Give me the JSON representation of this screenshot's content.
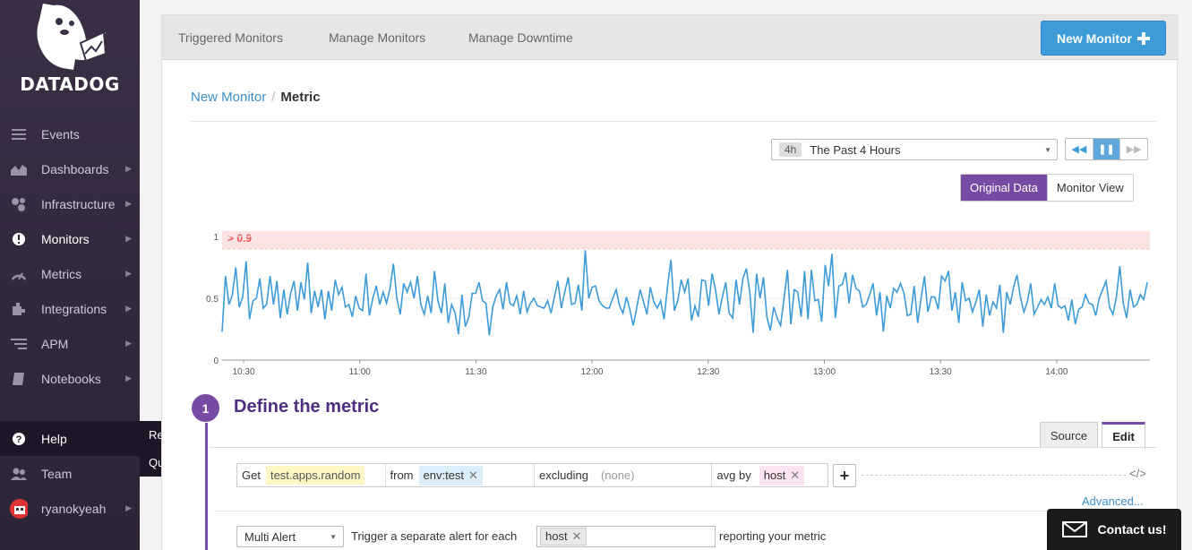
{
  "brand": {
    "name": "DATADOG",
    "accent": "#774aa4",
    "link": "#3d8fc9"
  },
  "sidebar": {
    "items": [
      {
        "label": "Events",
        "icon": "events-icon",
        "chevron": false
      },
      {
        "label": "Dashboards",
        "icon": "dashboards-icon",
        "chevron": true
      },
      {
        "label": "Infrastructure",
        "icon": "infrastructure-icon",
        "chevron": true
      },
      {
        "label": "Monitors",
        "icon": "monitors-icon",
        "chevron": true,
        "active": true
      },
      {
        "label": "Metrics",
        "icon": "metrics-icon",
        "chevron": true
      },
      {
        "label": "Integrations",
        "icon": "integrations-icon",
        "chevron": true
      },
      {
        "label": "APM",
        "icon": "apm-icon",
        "chevron": true
      },
      {
        "label": "Notebooks",
        "icon": "notebooks-icon",
        "chevron": true
      }
    ],
    "help": {
      "label": "Help",
      "menu": [
        "Resources",
        "Quick Start"
      ]
    },
    "team": {
      "label": "Team"
    },
    "user": {
      "label": "ryanokyeah"
    }
  },
  "topbar": {
    "tabs": [
      "Triggered Monitors",
      "Manage Monitors",
      "Manage Downtime"
    ],
    "new_monitor": "New Monitor"
  },
  "breadcrumb": {
    "parent": "New Monitor",
    "separator": "/",
    "current": "Metric"
  },
  "timeframe": {
    "badge": "4h",
    "label": "The Past 4 Hours"
  },
  "view_toggle": {
    "original": "Original Data",
    "monitor": "Monitor View"
  },
  "chart_data": {
    "type": "line",
    "x": [
      "10:30",
      "11:00",
      "11:30",
      "12:00",
      "12:30",
      "13:00",
      "13:30",
      "14:00"
    ],
    "y_ticks": [
      "0",
      "0.5",
      "1"
    ],
    "ylim": [
      0,
      1
    ],
    "threshold": {
      "label": "> 0.9",
      "value": 0.9,
      "color": "#f05252"
    },
    "series": [
      {
        "color": "#3d9bd8",
        "values": [
          0.23,
          0.68,
          0.45,
          0.53,
          0.75,
          0.43,
          0.51,
          0.8,
          0.33,
          0.48,
          0.5,
          0.66,
          0.42,
          0.45,
          0.68,
          0.45,
          0.64,
          0.34,
          0.57,
          0.37,
          0.54,
          0.64,
          0.4,
          0.63,
          0.49,
          0.79,
          0.38,
          0.56,
          0.43,
          0.57,
          0.33,
          0.56,
          0.4,
          0.65,
          0.53,
          0.59,
          0.43,
          0.45,
          0.35,
          0.52,
          0.42,
          0.4,
          0.7,
          0.36,
          0.5,
          0.6,
          0.45,
          0.55,
          0.46,
          0.58,
          0.78,
          0.5,
          0.37,
          0.62,
          0.55,
          0.63,
          0.5,
          0.68,
          0.45,
          0.37,
          0.52,
          0.38,
          0.72,
          0.48,
          0.38,
          0.62,
          0.3,
          0.45,
          0.38,
          0.21,
          0.53,
          0.27,
          0.35,
          0.54,
          0.54,
          0.63,
          0.48,
          0.46,
          0.2,
          0.43,
          0.52,
          0.57,
          0.41,
          0.63,
          0.46,
          0.44,
          0.52,
          0.37,
          0.56,
          0.39,
          0.46,
          0.5,
          0.44,
          0.43,
          0.42,
          0.48,
          0.38,
          0.51,
          0.64,
          0.42,
          0.55,
          0.67,
          0.45,
          0.46,
          0.61,
          0.4,
          0.89,
          0.5,
          0.59,
          0.6,
          0.48,
          0.44,
          0.42,
          0.42,
          0.5,
          0.57,
          0.44,
          0.38,
          0.51,
          0.41,
          0.28,
          0.42,
          0.57,
          0.47,
          0.37,
          0.59,
          0.47,
          0.42,
          0.48,
          0.33,
          0.6,
          0.81,
          0.4,
          0.48,
          0.65,
          0.55,
          0.66,
          0.32,
          0.44,
          0.35,
          0.65,
          0.64,
          0.44,
          0.7,
          0.57,
          0.37,
          0.51,
          0.63,
          0.38,
          0.34,
          0.65,
          0.45,
          0.66,
          0.74,
          0.55,
          0.22,
          0.7,
          0.5,
          0.67,
          0.35,
          0.24,
          0.43,
          0.34,
          0.28,
          0.5,
          0.73,
          0.29,
          0.57,
          0.55,
          0.35,
          0.72,
          0.33,
          0.73,
          0.48,
          0.49,
          0.31,
          0.77,
          0.6,
          0.86,
          0.34,
          0.6,
          0.61,
          0.71,
          0.46,
          0.69,
          0.58,
          0.56,
          0.43,
          0.45,
          0.53,
          0.62,
          0.36,
          0.55,
          0.23,
          0.52,
          0.42,
          0.58,
          0.55,
          0.62,
          0.54,
          0.36,
          0.37,
          0.6,
          0.3,
          0.5,
          0.68,
          0.39,
          0.51,
          0.51,
          0.41,
          0.68,
          0.64,
          0.72,
          0.4,
          0.55,
          0.3,
          0.63,
          0.48,
          0.5,
          0.39,
          0.47,
          0.57,
          0.27,
          0.53,
          0.36,
          0.47,
          0.42,
          0.61,
          0.22,
          0.55,
          0.45,
          0.59,
          0.69,
          0.51,
          0.39,
          0.47,
          0.62,
          0.37,
          0.43,
          0.49,
          0.45,
          0.51,
          0.42,
          0.62,
          0.44,
          0.42,
          0.44,
          0.32,
          0.49,
          0.29,
          0.41,
          0.43,
          0.53,
          0.46,
          0.45,
          0.36,
          0.5,
          0.57,
          0.64,
          0.43,
          0.37,
          0.51,
          0.76,
          0.46,
          0.34,
          0.57,
          0.43,
          0.45,
          0.53,
          0.49,
          0.63
        ]
      }
    ]
  },
  "define": {
    "step": "1",
    "title": "Define the metric",
    "tabs": {
      "source": "Source",
      "edit": "Edit"
    },
    "query": {
      "get": "Get",
      "metric": "test.apps.random",
      "from_label": "from",
      "from_tag": "env:test",
      "excluding_label": "excluding",
      "excluding_value": "(none)",
      "avg_label": "avg by",
      "avg_tag": "host"
    },
    "advanced": "Advanced...",
    "alert_type": "Multi Alert",
    "trigger_prefix": "Trigger a separate alert for each",
    "trigger_tag": "host",
    "trigger_suffix": "reporting your metric"
  },
  "contact": {
    "label": "Contact us!"
  }
}
